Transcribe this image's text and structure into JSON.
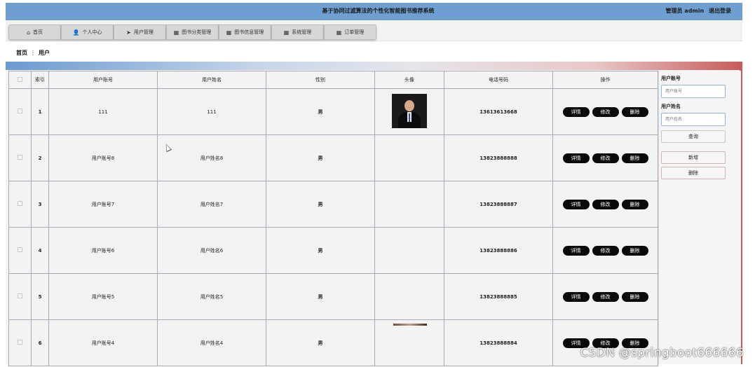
{
  "header": {
    "title": "基于协同过滤算法的个性化智能图书推荐系统",
    "role_user": "管理员 admin",
    "logout": "退出登录"
  },
  "nav": [
    {
      "label": "首页",
      "icon": "home-icon"
    },
    {
      "label": "个人中心",
      "icon": "user-icon"
    },
    {
      "label": "用户管理",
      "icon": "send-icon"
    },
    {
      "label": "图书分类管理",
      "icon": "grid-icon"
    },
    {
      "label": "图书信息管理",
      "icon": "grid-icon"
    },
    {
      "label": "系统管理",
      "icon": "grid-icon"
    },
    {
      "label": "订单管理",
      "icon": "grid-icon"
    }
  ],
  "breadcrumb": {
    "home": "首页",
    "separator": "⋮",
    "current": "用户"
  },
  "table": {
    "columns": [
      "",
      "索引",
      "用户账号",
      "用户姓名",
      "性别",
      "头像",
      "电话号码",
      "操作"
    ],
    "actions": {
      "detail": "详情",
      "edit": "修改",
      "delete": "删除"
    },
    "rows": [
      {
        "index": "1",
        "account": "111",
        "name": "111",
        "gender": "男",
        "avatar": "photo",
        "phone": "13613613668"
      },
      {
        "index": "2",
        "account": "用户账号8",
        "name": "用户姓名8",
        "gender": "男",
        "avatar": "",
        "phone": "13823888888"
      },
      {
        "index": "3",
        "account": "用户账号7",
        "name": "用户姓名7",
        "gender": "男",
        "avatar": "",
        "phone": "13823888887"
      },
      {
        "index": "4",
        "account": "用户账号6",
        "name": "用户姓名6",
        "gender": "男",
        "avatar": "",
        "phone": "13823888886"
      },
      {
        "index": "5",
        "account": "用户账号5",
        "name": "用户姓名5",
        "gender": "男",
        "avatar": "",
        "phone": "13823888885"
      },
      {
        "index": "6",
        "account": "用户账号4",
        "name": "用户姓名4",
        "gender": "男",
        "avatar": "partial",
        "phone": "13823888884"
      }
    ]
  },
  "search": {
    "account_label": "用户账号",
    "account_placeholder": "用户账号",
    "name_label": "用户姓名",
    "name_placeholder": "用户姓名",
    "query": "查询",
    "add": "新增",
    "delete": "删除"
  },
  "watermark": "CSDN @springboot666666",
  "colors": {
    "header": "#6f9fd0",
    "button": "#0a0a0a",
    "accent_right": "#c95a5a"
  }
}
